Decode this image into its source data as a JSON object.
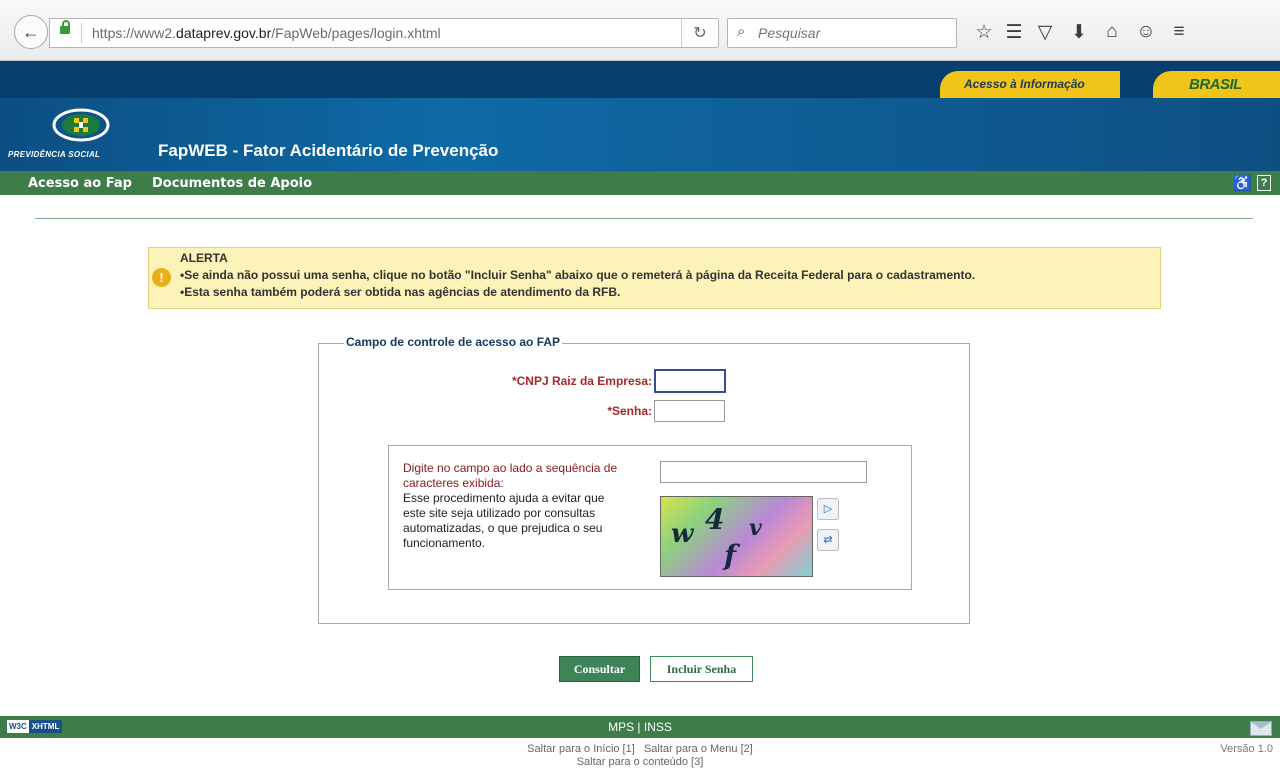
{
  "browser": {
    "url_prefix": "https://www2.",
    "url_domain": "dataprev.gov.br",
    "url_path": "/FapWeb/pages/login.xhtml",
    "search_placeholder": "Pesquisar"
  },
  "header": {
    "acesso_info": "Acesso à Informação",
    "brasil": "BRASIL",
    "logo_text": "PREVIDÊNCIA SOCIAL",
    "app_title": "FapWEB - Fator Acidentário de Prevenção"
  },
  "menu": {
    "items": [
      "Acesso ao Fap",
      "Documentos de Apoio"
    ],
    "help": "?"
  },
  "alert": {
    "title": "ALERTA",
    "line1": "•Se ainda não possui uma senha, clique no botão \"Incluir Senha\" abaixo que o remeterá à página da Receita Federal para o cadastramento.",
    "line2": "•Esta senha também poderá ser obtida nas agências de atendimento da RFB."
  },
  "form": {
    "legend": "Campo de controle de acesso ao FAP",
    "cnpj_label": "*CNPJ Raiz da Empresa:",
    "cnpj_value": "",
    "senha_label": "*Senha:",
    "senha_value": "",
    "captcha_instruction": "Digite no campo ao lado a sequência de caracteres exibida:",
    "captcha_explanation": "Esse procedimento ajuda a evitar que este site seja utilizado por consultas automatizadas, o que prejudica o seu funcionamento.",
    "captcha_value": "",
    "captcha_chars": [
      "w",
      "4",
      "f",
      "v"
    ]
  },
  "buttons": {
    "consultar": "Consultar",
    "incluir": "Incluir Senha"
  },
  "footer": {
    "w3c": "W3C",
    "xhtml": "XHTML",
    "center": "MPS | INSS",
    "link1": "Saltar para o Início [1]",
    "link2": "Saltar para o Menu [2]",
    "link3": "Saltar para o conteúdo [3]",
    "version": "Versão 1.0"
  },
  "colors": {
    "header_blue": "#063f6d",
    "menu_green": "#3e7d4a",
    "alert_yellow": "#fcf3b8",
    "label_red": "#a52a2a"
  }
}
